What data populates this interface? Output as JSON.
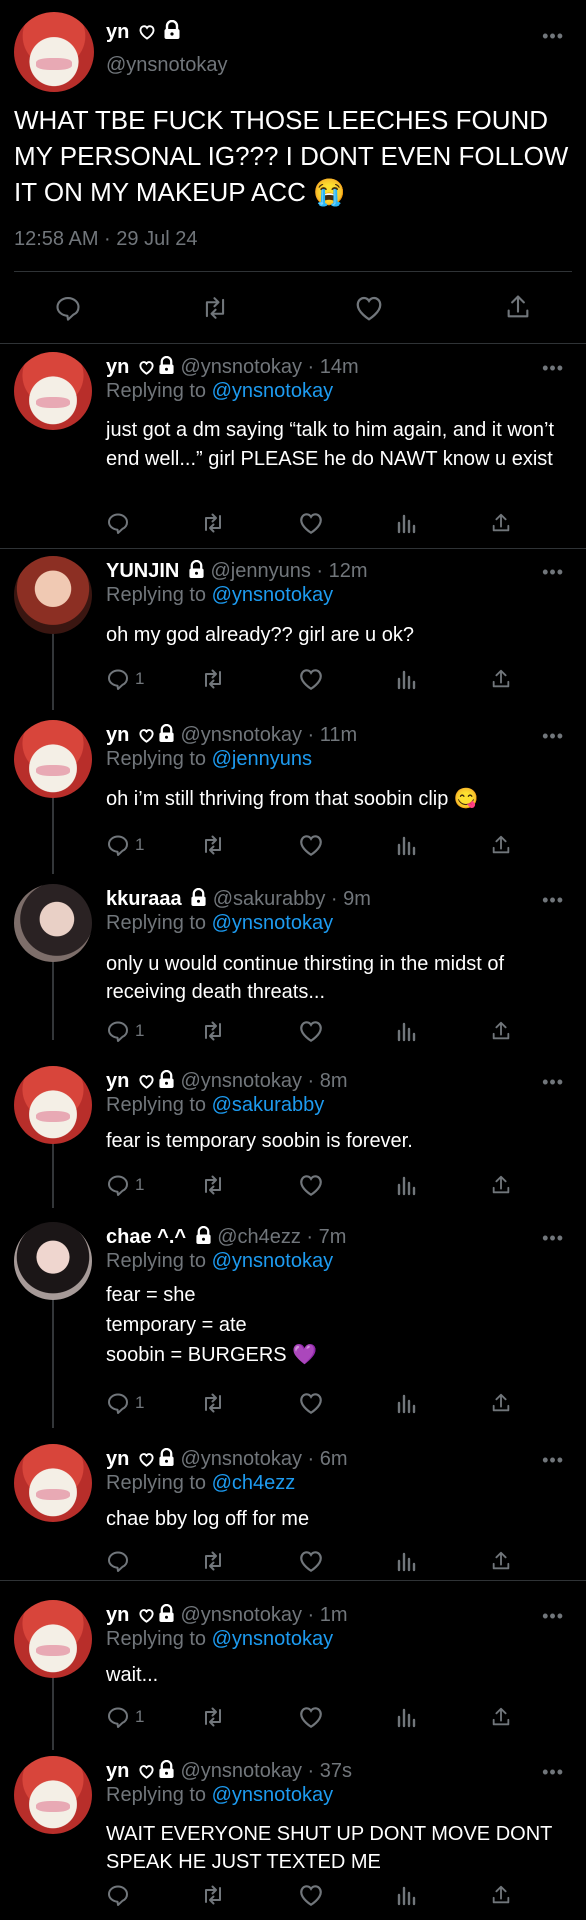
{
  "main": {
    "name": "yn",
    "handle": "@ynsnotokay",
    "text": "WHAT TBE FUCK THOSE LEECHES FOUND MY PERSONAL IG??? I DONT EVEN FOLLOW IT ON MY MAKEUP ACC 😭",
    "timestamp": "12:58 AM · 29 Jul 24"
  },
  "replies": [
    {
      "name": "yn",
      "handle": "@ynsnotokay · 14m",
      "replying_label": "Replying to",
      "replying_to": "@ynsnotokay",
      "lines": [
        "just got a dm saying “talk to him again, and it won’t end well...” girl PLEASE he do NAWT know u exist"
      ],
      "reply_count": ""
    },
    {
      "name": "YUNJIN",
      "handle": "@jennyuns · 12m",
      "replying_label": "Replying to",
      "replying_to": "@ynsnotokay",
      "lines": [
        "oh my god already?? girl are u ok?"
      ],
      "reply_count": "1"
    },
    {
      "name": "yn",
      "handle": "@ynsnotokay · 11m",
      "replying_label": "Replying to",
      "replying_to": "@jennyuns",
      "lines": [
        "oh i’m still thriving from that soobin clip 😋"
      ],
      "reply_count": "1"
    },
    {
      "name": "kkuraaa",
      "handle": "@sakurabby · 9m",
      "replying_label": "Replying to",
      "replying_to": "@ynsnotokay",
      "lines": [
        "only u would continue thirsting in the midst of receiving death threats..."
      ],
      "reply_count": "1"
    },
    {
      "name": "yn",
      "handle": "@ynsnotokay · 8m",
      "replying_label": "Replying to",
      "replying_to": "@sakurabby",
      "lines": [
        "fear is temporary soobin is forever."
      ],
      "reply_count": "1"
    },
    {
      "name": "chae ^.^",
      "handle": "@ch4ezz · 7m",
      "replying_label": "Replying to",
      "replying_to": "@ynsnotokay",
      "lines": [
        "fear = she",
        "temporary = ate",
        "soobin = BURGERS 💜"
      ],
      "reply_count": "1"
    },
    {
      "name": "yn",
      "handle": "@ynsnotokay · 6m",
      "replying_label": "Replying to",
      "replying_to": "@ch4ezz",
      "lines": [
        "chae bby log off for me"
      ],
      "reply_count": ""
    },
    {
      "name": "yn",
      "handle": "@ynsnotokay · 1m",
      "replying_label": "Replying to",
      "replying_to": "@ynsnotokay",
      "lines": [
        "wait..."
      ],
      "reply_count": "1"
    },
    {
      "name": "yn",
      "handle": "@ynsnotokay · 37s",
      "replying_label": "Replying to",
      "replying_to": "@ynsnotokay",
      "lines": [
        "WAIT EVERYONE SHUT UP DONT MOVE DONT SPEAK HE JUST TEXTED ME"
      ],
      "reply_count": ""
    }
  ],
  "icons": {
    "more": "more-icon",
    "reply": "reply-icon",
    "retweet": "retweet-icon",
    "like": "heart-icon",
    "views": "views-icon",
    "share": "share-icon",
    "heart_badge": "heart-outline-icon",
    "lock": "lock-icon"
  },
  "colors": {
    "accent": "#1d9bf0",
    "muted": "#71767b",
    "text": "#e7e9ea",
    "background": "#000000",
    "divider": "#2f3336"
  }
}
